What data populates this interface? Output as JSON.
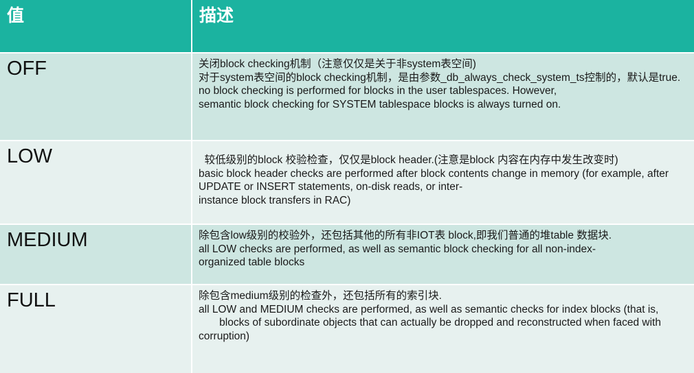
{
  "header": {
    "value_label": "值",
    "description_label": "描述"
  },
  "rows": [
    {
      "value": "OFF",
      "description": "关闭block checking机制（注意仅仅是关于非system表空间)\n对于system表空间的block checking机制，是由参数_db_always_check_system_ts控制的，默认是true.\nno block checking is performed for blocks in the user tablespaces. However,\nsemantic block checking for SYSTEM tablespace blocks is always turned on."
    },
    {
      "value": "LOW",
      "description": "  较低级别的block 校验检查，仅仅是block header.(注意是block 内容在内存中发生改变时)\nbasic block header checks are performed after block contents change in memory (for example, after UPDATE or INSERT statements, on-disk reads, or inter-\ninstance block transfers in RAC)"
    },
    {
      "value": "MEDIUM",
      "description": "除包含low级别的校验外，还包括其他的所有非IOT表 block,即我们普通的堆table 数据块.\nall LOW checks are performed, as well as semantic block checking for all non-index-\norganized table blocks"
    },
    {
      "value": "FULL",
      "description": "除包含medium级别的检查外，还包括所有的索引块.\nall LOW and MEDIUM checks are performed, as well as semantic checks for index blocks (that is,\n       blocks of subordinate objects that can actually be dropped and reconstructed when faced with corruption)"
    }
  ]
}
